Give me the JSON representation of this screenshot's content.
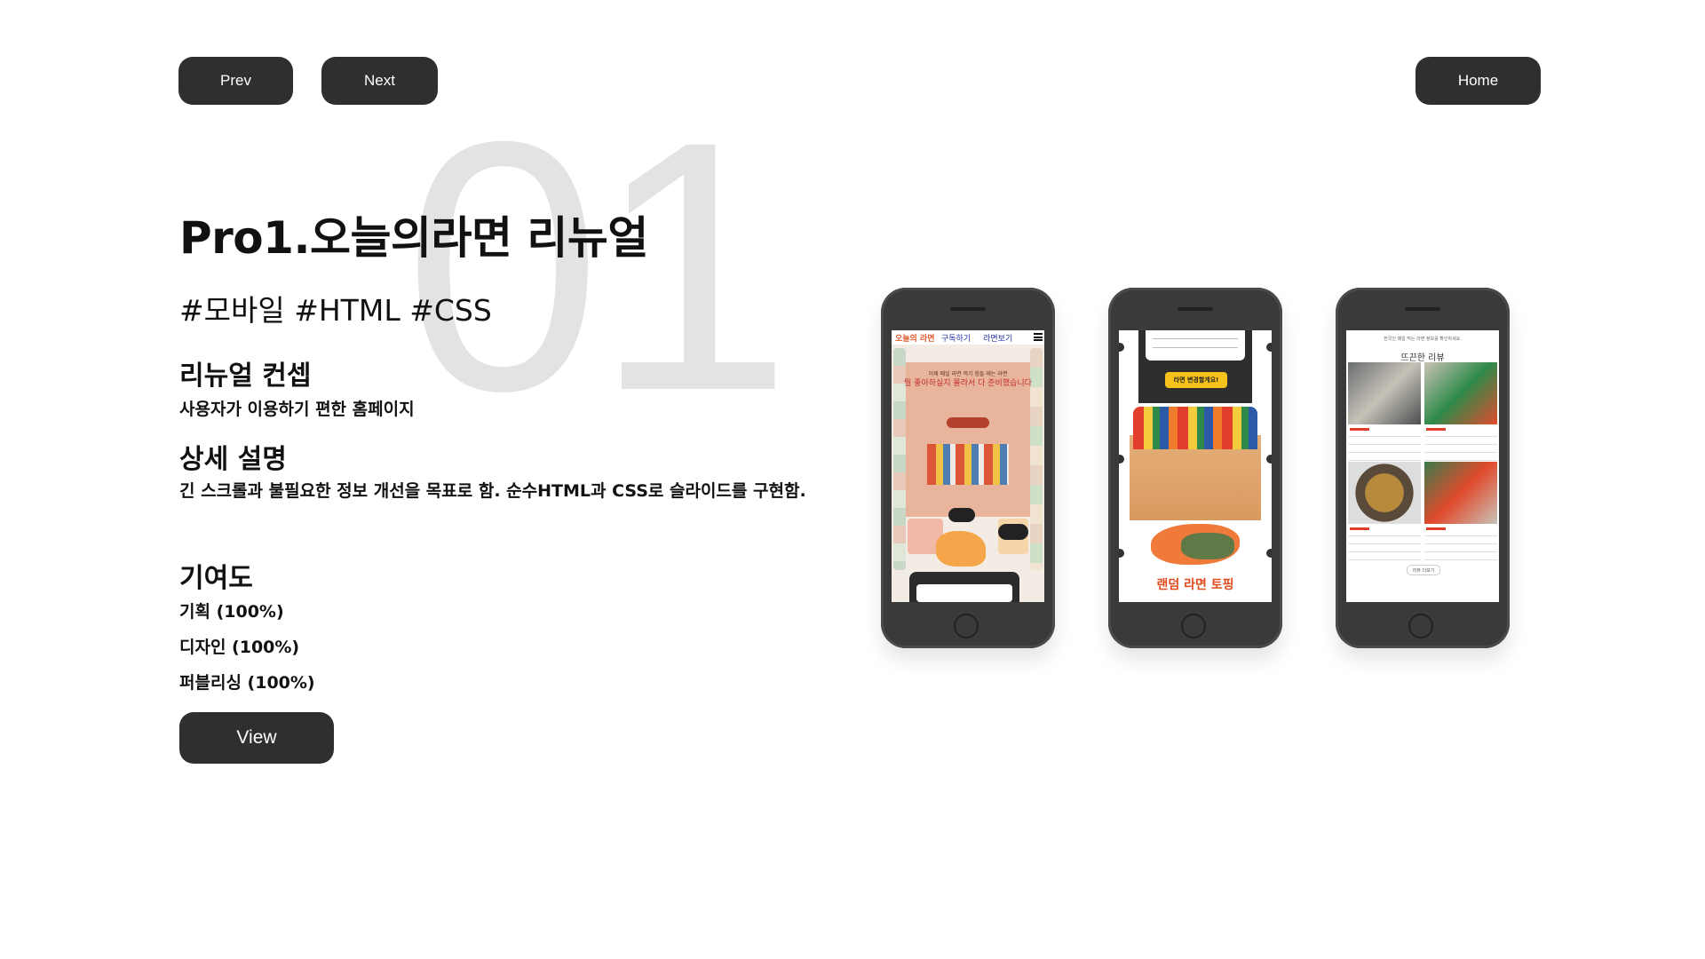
{
  "nav": {
    "prev_label": "Prev",
    "next_label": "Next",
    "home_label": "Home"
  },
  "project": {
    "number": "01",
    "title": "Pro1.오늘의라면 리뉴얼",
    "tags": "#모바일 #HTML #CSS",
    "concept_heading": "리뉴얼 컨셉",
    "concept_text": "사용자가 이용하기 편한 홈페이지",
    "detail_heading": "상세 설명",
    "detail_text": "긴 스크롤과 불필요한 정보 개선을 목표로 함. 순수HTML과 CSS로 슬라이드를 구현함.",
    "contribution_heading": "기여도",
    "contributions": [
      "기획 (100%)",
      "디자인 (100%)",
      "퍼블리싱 (100%)"
    ],
    "view_label": "View"
  },
  "phones": {
    "screen1": {
      "logo": "오늘의 라면",
      "nav1": "구독하기",
      "nav2": "라면보기",
      "line1": "이제 매일 라면 먹기 힘들 때는 라면",
      "line2": "뭘 좋아하실지 몰라서 다 준비했습니다"
    },
    "screen2": {
      "yellow_button": "라면 변경할게요!",
      "title": "랜덤 라면 토핑"
    },
    "screen3": {
      "header": "한국인 매일 먹는 라면 정보를 확인하세요.",
      "title": "뜨끈한 리뷰",
      "more": "리뷰 더보기"
    }
  }
}
